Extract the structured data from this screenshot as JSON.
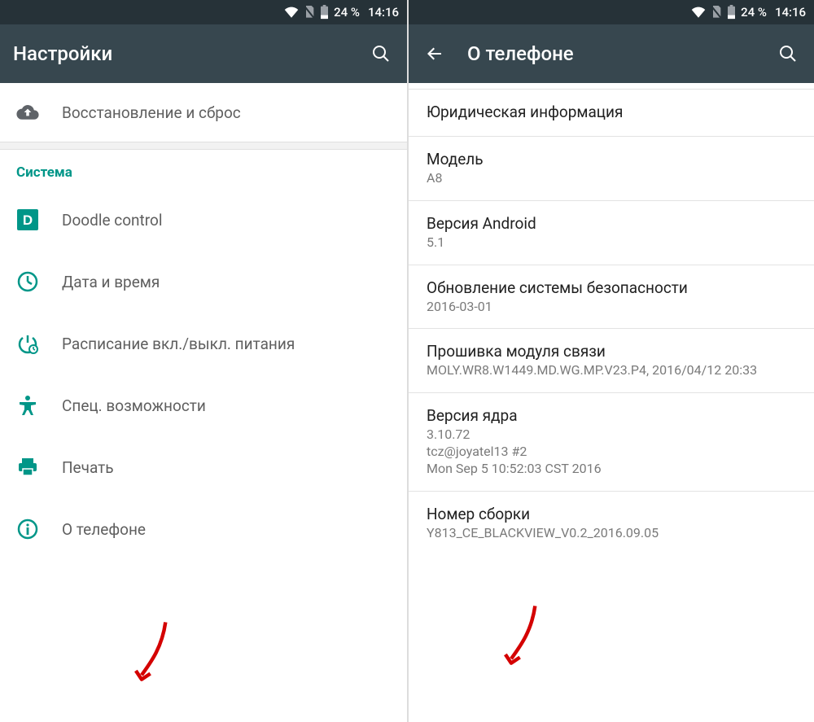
{
  "status": {
    "battery": "24 %",
    "time": "14:16"
  },
  "left": {
    "title": "Настройки",
    "backupRow": "Восстановление и сброс",
    "sectionHeader": "Система",
    "items": [
      {
        "label": "Doodle control"
      },
      {
        "label": "Дата и время"
      },
      {
        "label": "Расписание вкл./выкл. питания"
      },
      {
        "label": "Спец. возможности"
      },
      {
        "label": "Печать"
      },
      {
        "label": "О телефоне"
      }
    ]
  },
  "right": {
    "title": "О телефоне",
    "rows": [
      {
        "title": "Юридическая информация",
        "sub": ""
      },
      {
        "title": "Модель",
        "sub": "A8"
      },
      {
        "title": "Версия Android",
        "sub": "5.1"
      },
      {
        "title": "Обновление системы безопасности",
        "sub": "2016-03-01"
      },
      {
        "title": "Прошивка модуля связи",
        "sub": "MOLY.WR8.W1449.MD.WG.MP.V23.P4, 2016/04/12 20:33"
      },
      {
        "title": "Версия ядра",
        "sub": "3.10.72\ntcz@joyatel13 #2\nMon Sep 5 10:52:03 CST 2016"
      },
      {
        "title": "Номер сборки",
        "sub": "Y813_CE_BLACKVIEW_V0.2_2016.09.05"
      }
    ]
  }
}
